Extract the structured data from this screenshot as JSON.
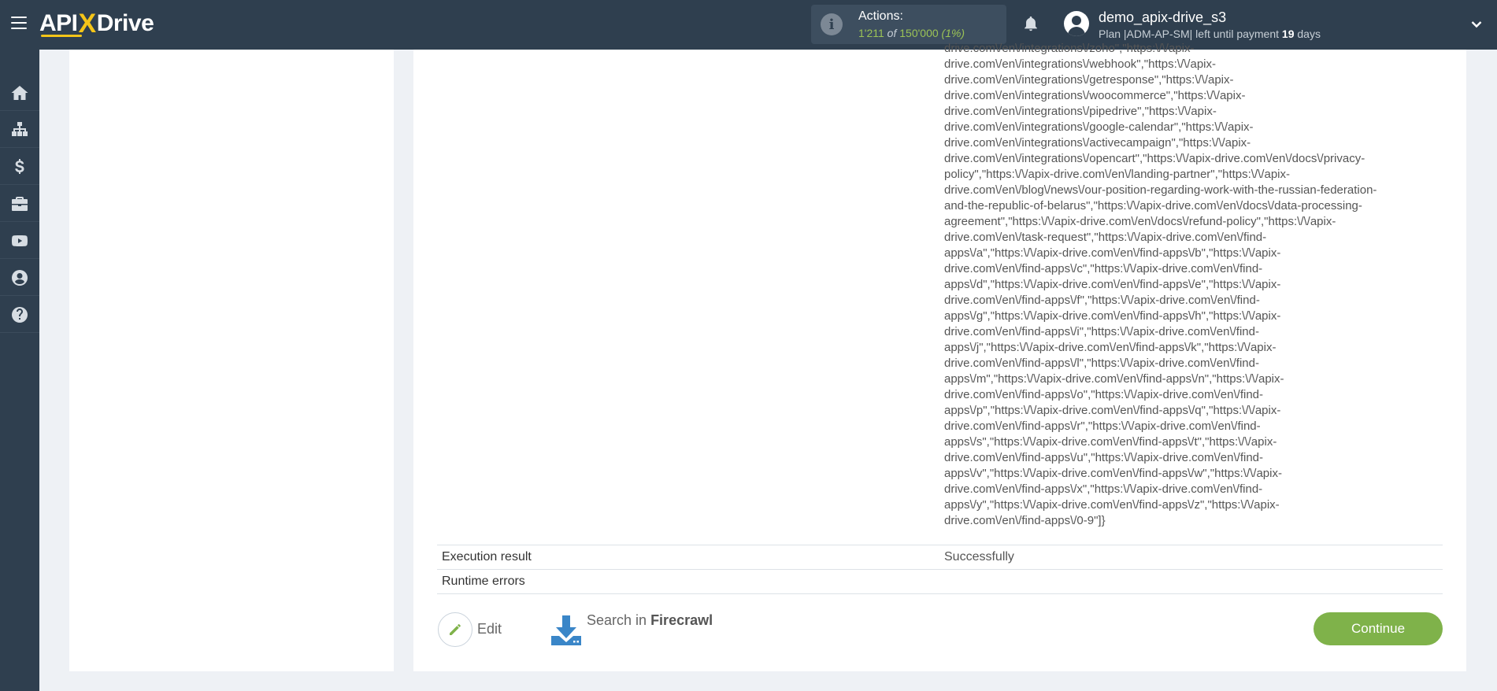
{
  "header": {
    "logo_api": "API",
    "logo_x": "X",
    "logo_drive": "Drive",
    "actions_label": "Actions:",
    "actions_used": "1'211",
    "actions_of": "of",
    "actions_total": "150'000",
    "actions_pct": "(1%)",
    "username": "demo_apix-drive_s3",
    "plan_prefix": "Plan |ADM-AP-SM| left until payment",
    "plan_days": "19",
    "plan_suffix": "days"
  },
  "sidebar": {
    "items": [
      {
        "icon": "home-icon"
      },
      {
        "icon": "sitemap-icon"
      },
      {
        "icon": "dollar-icon"
      },
      {
        "icon": "briefcase-icon"
      },
      {
        "icon": "youtube-icon"
      },
      {
        "icon": "user-circle-icon"
      },
      {
        "icon": "question-circle-icon"
      }
    ]
  },
  "result": {
    "data_lines": [
      "drive.com\\/en\\/integrations\\/zoho\",\"https:\\/\\/apix-",
      "drive.com\\/en\\/integrations\\/webhook\",\"https:\\/\\/apix-",
      "drive.com\\/en\\/integrations\\/getresponse\",\"https:\\/\\/apix-",
      "drive.com\\/en\\/integrations\\/woocommerce\",\"https:\\/\\/apix-",
      "drive.com\\/en\\/integrations\\/pipedrive\",\"https:\\/\\/apix-",
      "drive.com\\/en\\/integrations\\/google-calendar\",\"https:\\/\\/apix-",
      "drive.com\\/en\\/integrations\\/activecampaign\",\"https:\\/\\/apix-",
      "drive.com\\/en\\/integrations\\/opencart\",\"https:\\/\\/apix-drive.com\\/en\\/docs\\/privacy-",
      "policy\",\"https:\\/\\/apix-drive.com\\/en\\/landing-partner\",\"https:\\/\\/apix-",
      "drive.com\\/en\\/blog\\/news\\/our-position-regarding-work-with-the-russian-federation-",
      "and-the-republic-of-belarus\",\"https:\\/\\/apix-drive.com\\/en\\/docs\\/data-processing-",
      "agreement\",\"https:\\/\\/apix-drive.com\\/en\\/docs\\/refund-policy\",\"https:\\/\\/apix-",
      "drive.com\\/en\\/task-request\",\"https:\\/\\/apix-drive.com\\/en\\/find-",
      "apps\\/a\",\"https:\\/\\/apix-drive.com\\/en\\/find-apps\\/b\",\"https:\\/\\/apix-",
      "drive.com\\/en\\/find-apps\\/c\",\"https:\\/\\/apix-drive.com\\/en\\/find-",
      "apps\\/d\",\"https:\\/\\/apix-drive.com\\/en\\/find-apps\\/e\",\"https:\\/\\/apix-",
      "drive.com\\/en\\/find-apps\\/f\",\"https:\\/\\/apix-drive.com\\/en\\/find-",
      "apps\\/g\",\"https:\\/\\/apix-drive.com\\/en\\/find-apps\\/h\",\"https:\\/\\/apix-",
      "drive.com\\/en\\/find-apps\\/i\",\"https:\\/\\/apix-drive.com\\/en\\/find-",
      "apps\\/j\",\"https:\\/\\/apix-drive.com\\/en\\/find-apps\\/k\",\"https:\\/\\/apix-",
      "drive.com\\/en\\/find-apps\\/l\",\"https:\\/\\/apix-drive.com\\/en\\/find-",
      "apps\\/m\",\"https:\\/\\/apix-drive.com\\/en\\/find-apps\\/n\",\"https:\\/\\/apix-",
      "drive.com\\/en\\/find-apps\\/o\",\"https:\\/\\/apix-drive.com\\/en\\/find-",
      "apps\\/p\",\"https:\\/\\/apix-drive.com\\/en\\/find-apps\\/q\",\"https:\\/\\/apix-",
      "drive.com\\/en\\/find-apps\\/r\",\"https:\\/\\/apix-drive.com\\/en\\/find-",
      "apps\\/s\",\"https:\\/\\/apix-drive.com\\/en\\/find-apps\\/t\",\"https:\\/\\/apix-",
      "drive.com\\/en\\/find-apps\\/u\",\"https:\\/\\/apix-drive.com\\/en\\/find-",
      "apps\\/v\",\"https:\\/\\/apix-drive.com\\/en\\/find-apps\\/w\",\"https:\\/\\/apix-",
      "drive.com\\/en\\/find-apps\\/x\",\"https:\\/\\/apix-drive.com\\/en\\/find-",
      "apps\\/y\",\"https:\\/\\/apix-drive.com\\/en\\/find-apps\\/z\",\"https:\\/\\/apix-",
      "drive.com\\/en\\/find-apps\\/0-9\"]}"
    ],
    "execution_label": "Execution result",
    "execution_value": "Successfully",
    "errors_label": "Runtime errors",
    "errors_value": ""
  },
  "actions": {
    "edit_label": "Edit",
    "search_prefix": "Search in",
    "search_service": "Firecrawl",
    "continue_label": "Continue"
  },
  "colors": {
    "topbar": "#2f3f4f",
    "accent_green": "#7fb24a",
    "logo_yellow": "#f5c518"
  }
}
